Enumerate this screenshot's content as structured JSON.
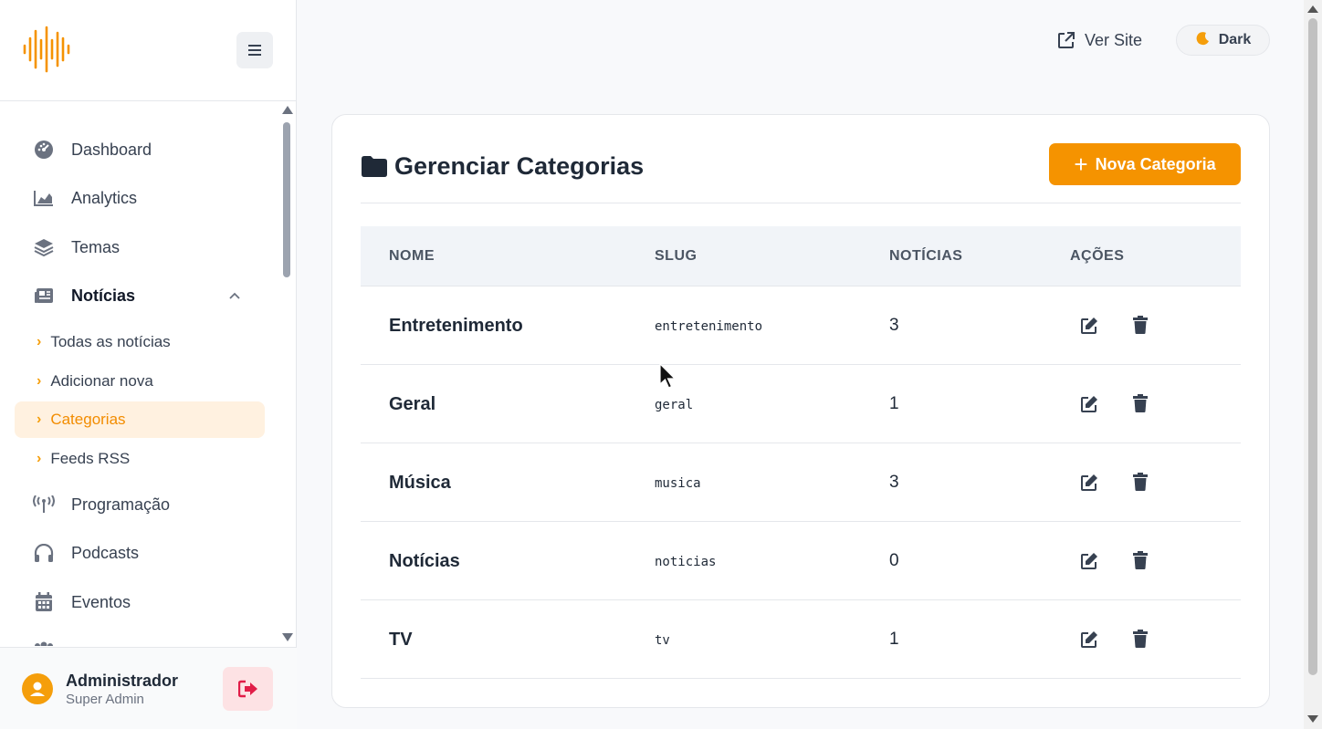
{
  "topbar": {
    "ver_site": "Ver Site",
    "theme_toggle": "Dark"
  },
  "sidebar": {
    "items": [
      {
        "label": "Dashboard",
        "icon": "gauge-icon"
      },
      {
        "label": "Analytics",
        "icon": "chart-area-icon"
      },
      {
        "label": "Temas",
        "icon": "layers-icon"
      },
      {
        "label": "Notícias",
        "icon": "newspaper-icon"
      },
      {
        "label": "Programação",
        "icon": "broadcast-tower-icon"
      },
      {
        "label": "Podcasts",
        "icon": "headphones-icon"
      },
      {
        "label": "Eventos",
        "icon": "calendar-icon"
      }
    ],
    "sub_items": [
      {
        "label": "Todas as notícias"
      },
      {
        "label": "Adicionar nova"
      },
      {
        "label": "Categorias",
        "active": true
      },
      {
        "label": "Feeds RSS"
      }
    ],
    "user": {
      "name": "Administrador",
      "role": "Super Admin"
    }
  },
  "card": {
    "title": "Gerenciar Categorias",
    "new_button": "Nova Categoria",
    "columns": [
      "NOME",
      "SLUG",
      "NOTÍCIAS",
      "AÇÕES"
    ],
    "rows": [
      {
        "name": "Entretenimento",
        "slug": "entretenimento",
        "count": "3"
      },
      {
        "name": "Geral",
        "slug": "geral",
        "count": "1"
      },
      {
        "name": "Música",
        "slug": "musica",
        "count": "3"
      },
      {
        "name": "Notícias",
        "slug": "noticias",
        "count": "0"
      },
      {
        "name": "TV",
        "slug": "tv",
        "count": "1"
      }
    ]
  },
  "colors": {
    "accent": "#f59300",
    "active_bg": "#fff1e0",
    "active_text": "#f28c00",
    "logout_bg": "#fde2e4",
    "logout_icon": "#e11d48"
  }
}
